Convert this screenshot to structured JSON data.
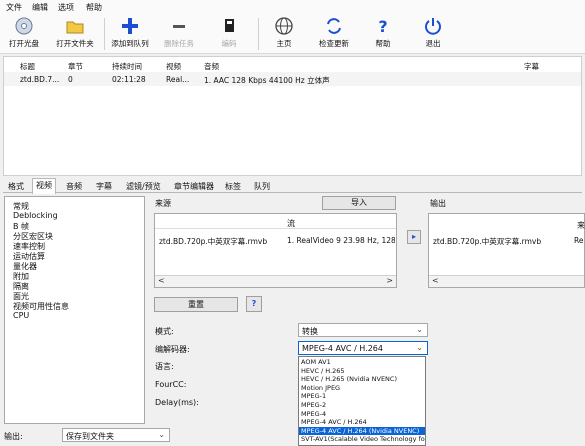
{
  "menu": {
    "items": [
      "文件",
      "编辑",
      "选项",
      "帮助"
    ]
  },
  "toolbar": {
    "buttons": [
      {
        "label": "打开光盘",
        "icon": "disc-icon"
      },
      {
        "label": "打开文件夹",
        "icon": "folder-icon"
      },
      {
        "label": "添加到队列",
        "icon": "plus-icon"
      },
      {
        "label": "删除任务",
        "icon": "minus-icon"
      },
      {
        "label": "编码",
        "icon": "encode-icon"
      },
      {
        "label": "主页",
        "icon": "globe-icon"
      },
      {
        "label": "检查更新",
        "icon": "refresh-icon"
      },
      {
        "label": "帮助",
        "icon": "help-icon"
      },
      {
        "label": "退出",
        "icon": "power-icon"
      }
    ]
  },
  "queue": {
    "headers": [
      "标题",
      "章节",
      "持续时间",
      "视频",
      "音频",
      "字幕"
    ],
    "rows": [
      [
        "ztd.BD.7...",
        "0",
        "02:11:28",
        "Real...",
        "1. AAC  128 Kbps 44100 Hz 立体声",
        ""
      ]
    ]
  },
  "tabs": [
    "格式",
    "视频",
    "音频",
    "字幕",
    "滤镜/预览",
    "章节编辑器",
    "标签",
    "队列"
  ],
  "left_list": [
    "常规",
    "Deblocking",
    "B 帧",
    "分区宏区块",
    "速率控制",
    "运动估算",
    "量化器",
    "附加",
    "隔离",
    "面光",
    "视频可用性信息",
    "CPU"
  ],
  "source": {
    "label": "来源",
    "import_button": "导入",
    "stream_header": "流",
    "file": "ztd.BD.720p.中英双字幕.rmvb",
    "stream": "1. RealVideo 9 23.98 Hz, 1280 x"
  },
  "output": {
    "label": "输出",
    "header_partial": "来",
    "file": "ztd.BD.720p.中英双字幕.rmvb",
    "partial": "Re"
  },
  "controls": {
    "arrow_button": "▸",
    "reset_button": "重置",
    "help_button": "?",
    "mode_label": "模式:",
    "mode_value": "转换",
    "codec_label": "编解码器:",
    "codec_value": "MPEG-4 AVC / H.264",
    "language_label": "语言:",
    "fourcc_label": "FourCC:",
    "delay_label": "Delay(ms):"
  },
  "codec_options": [
    "AOM AV1",
    "HEVC / H.265",
    "HEVC / H.265 (Nvidia NVENC)",
    "Motion JPEG",
    "MPEG-1",
    "MPEG-2",
    "MPEG-4",
    "MPEG-4 AVC / H.264",
    "MPEG-4 AVC / H.264 (Nvidia NVENC)",
    "SVT-AV1(Scalable Video Technology for AV1 encod"
  ],
  "codec_selected_index": 8,
  "bottom": {
    "output_label": "输出:",
    "output_value": "保存到文件夹"
  },
  "colors": {
    "selection": "#0a64d6",
    "plus": "#1c4fd0"
  }
}
